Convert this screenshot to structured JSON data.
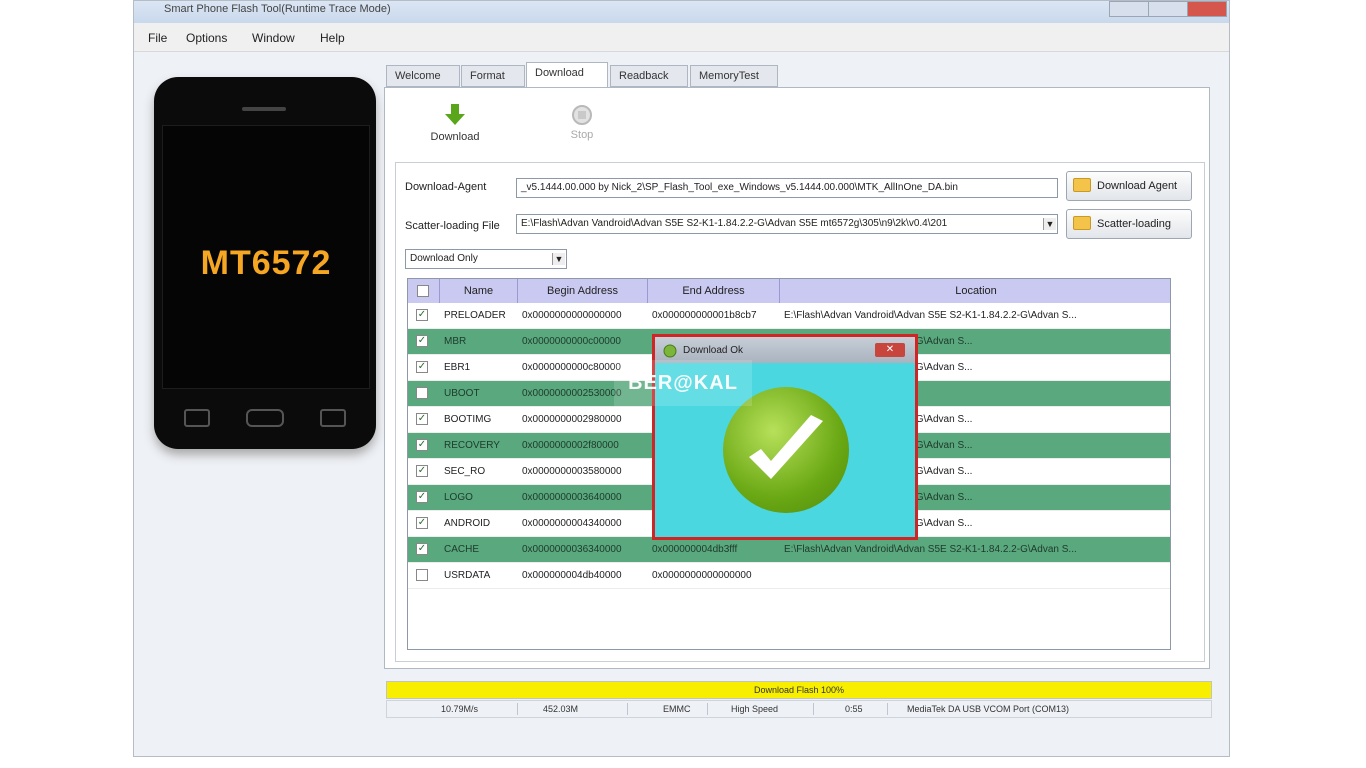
{
  "window": {
    "title": "Smart Phone Flash Tool(Runtime Trace Mode)",
    "menu": [
      "File",
      "Options",
      "Window",
      "Help"
    ]
  },
  "phone": {
    "model": "MT6572"
  },
  "tabs": [
    "Welcome",
    "Format",
    "Download",
    "Readback",
    "MemoryTest"
  ],
  "active_tab": "Download",
  "toolbar": {
    "download_label": "Download",
    "stop_label": "Stop"
  },
  "download_agent": {
    "label": "Download-Agent",
    "value": "_v5.1444.00.000 by Nick_2\\SP_Flash_Tool_exe_Windows_v5.1444.00.000\\MTK_AllInOne_DA.bin",
    "button": "Download Agent"
  },
  "scatter": {
    "label": "Scatter-loading File",
    "value": "E:\\Flash\\Advan Vandroid\\Advan S5E S2-K1-1.84.2.2-G\\Advan S5E mt6572g\\305\\n9\\2k\\v0.4\\201",
    "button": "Scatter-loading"
  },
  "mode_select": "Download Only",
  "table": {
    "columns": [
      "Name",
      "Begin Address",
      "End Address",
      "Location"
    ],
    "rows": [
      {
        "name": "PRELOADER",
        "begin": "0x0000000000000000",
        "end": "0x000000000001b8cb7",
        "location": "E:\\Flash\\Advan Vandroid\\Advan S5E S2-K1-1.84.2.2-G\\Advan S..."
      },
      {
        "name": "MBR",
        "begin": "0x0000000000c00000",
        "end": "",
        "location": "d\\Advan S5E S2-K1-1.84.2.2-G\\Advan S..."
      },
      {
        "name": "EBR1",
        "begin": "0x0000000000c80000",
        "end": "",
        "location": "d\\Advan S5E S2-K1-1.84.2.2-G\\Advan S..."
      },
      {
        "name": "UBOOT",
        "begin": "0x0000000002530000",
        "end": "",
        "location": ""
      },
      {
        "name": "BOOTIMG",
        "begin": "0x0000000002980000",
        "end": "",
        "location": "d\\Advan S5E S2-K1-1.84.2.2-G\\Advan S..."
      },
      {
        "name": "RECOVERY",
        "begin": "0x0000000002f80000",
        "end": "",
        "location": "d\\Advan S5E S2-K1-1.84.2.2-G\\Advan S..."
      },
      {
        "name": "SEC_RO",
        "begin": "0x0000000003580000",
        "end": "",
        "location": "d\\Advan S5E S2-K1-1.84.2.2-G\\Advan S..."
      },
      {
        "name": "LOGO",
        "begin": "0x0000000003640000",
        "end": "",
        "location": "d\\Advan S5E S2-K1-1.84.2.2-G\\Advan S..."
      },
      {
        "name": "ANDROID",
        "begin": "0x0000000004340000",
        "end": "",
        "location": "d\\Advan S5E S2-K1-1.84.2.2-G\\Advan S..."
      },
      {
        "name": "CACHE",
        "begin": "0x0000000036340000",
        "end": "0x000000004db3fff",
        "location": "E:\\Flash\\Advan Vandroid\\Advan S5E S2-K1-1.84.2.2-G\\Advan S..."
      },
      {
        "name": "USRDATA",
        "begin": "0x000000004db40000",
        "end": "0x0000000000000000",
        "location": ""
      }
    ]
  },
  "dialog": {
    "title": "Download Ok"
  },
  "watermark": "BER@KAL",
  "status": {
    "progress_text": "Download Flash 100%",
    "speed": "10.79M/s",
    "size": "452.03M",
    "storage": "EMMC",
    "mode": "High Speed",
    "time": "0:55",
    "port": "MediaTek DA USB VCOM Port (COM13)"
  }
}
